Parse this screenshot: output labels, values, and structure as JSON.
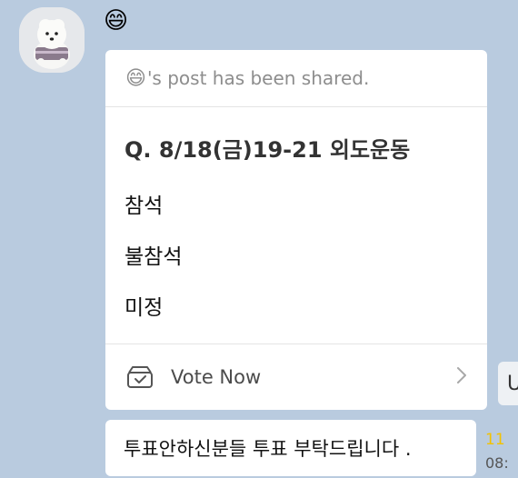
{
  "sender": {
    "name": "😄"
  },
  "vote_card": {
    "header_emoji": "😄",
    "header_text": "'s post has been shared.",
    "question": "Q. 8/18(금)19-21 외도운동",
    "options": [
      {
        "label": "참석"
      },
      {
        "label": "불참석"
      },
      {
        "label": "미정"
      }
    ],
    "footer_label": "Vote Now",
    "footer_icon": "ballot-box-icon",
    "chevron_icon": "chevron-right-icon"
  },
  "side_tab": {
    "label": "U"
  },
  "message": {
    "text": "투표안하신분들 투표 부탁드립니다 .",
    "unread_count": "11",
    "time": "08:"
  }
}
